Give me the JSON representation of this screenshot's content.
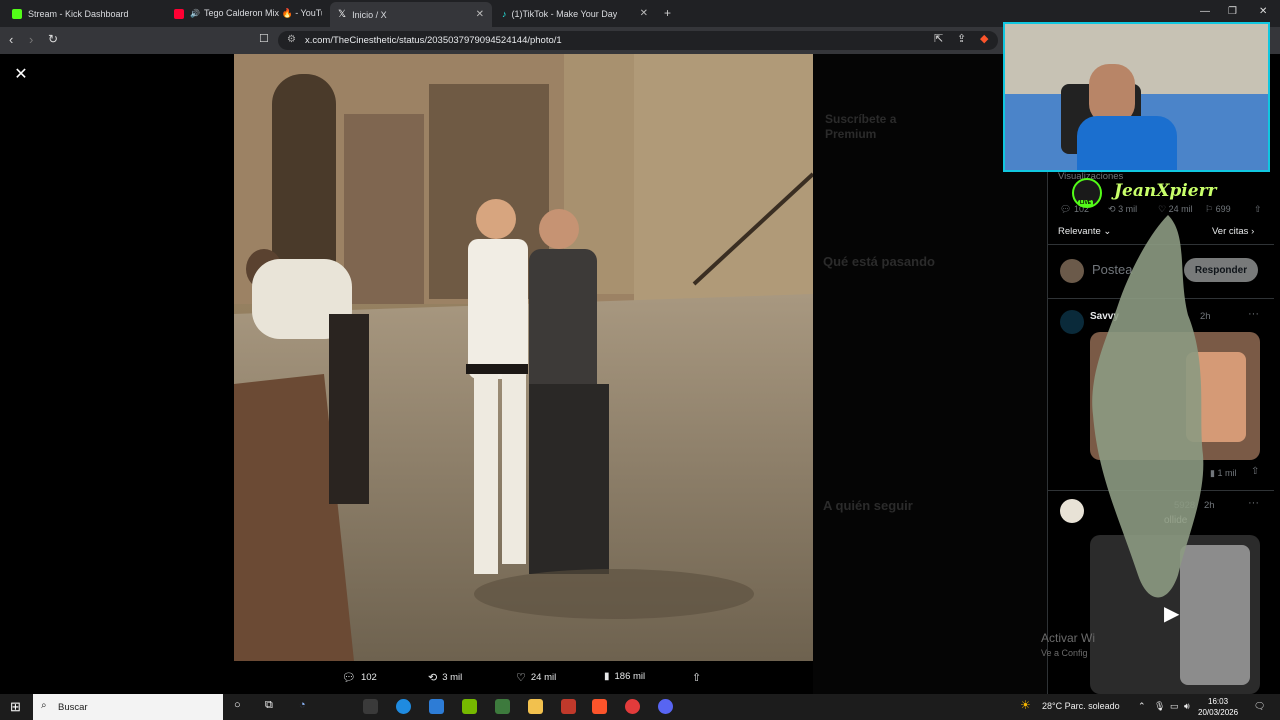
{
  "browser": {
    "tabs": [
      {
        "title": "Stream - Kick Dashboard",
        "favicon_color": "#53fc18"
      },
      {
        "title": "Tego Calderon Mix 🔥 - YouTube",
        "favicon_color": "#ff0033"
      },
      {
        "title": "Inicio / X",
        "favicon_color": "#ffffff"
      },
      {
        "title": "(1)TikTok - Make Your Day",
        "favicon_color": "#25f4ee"
      }
    ],
    "url": "x.com/TheCinesthetic/status/2035037979094524144/photo/1"
  },
  "post": {
    "actions": {
      "replies": "102",
      "reposts": "3 mil",
      "likes": "24 mil",
      "views": "186 mil"
    }
  },
  "sidebar_dimmed": {
    "premium_title": "Suscríbete a Premium",
    "trending_title": "Qué está pasando",
    "follow_title": "A quién seguir"
  },
  "panel": {
    "views_label": "Visualizaciones",
    "stats": {
      "replies": "102",
      "reposts": "3 mil",
      "likes": "24 mil",
      "bookmarks": "699"
    },
    "sort_label": "Relevante",
    "quotes_label": "Ver citas",
    "reply_placeholder": "Postea",
    "reply_button": "Responder",
    "replies": [
      {
        "author": "Savvy",
        "time": "2h",
        "views": "1 mil"
      },
      {
        "handle_tail": "5928",
        "time": "2h",
        "text_tail": "ollide"
      }
    ]
  },
  "stream_overlay": {
    "name": "JeanXpierr",
    "live_badge": "LIVE"
  },
  "windows_watermark": {
    "line1": "Activar Wi",
    "line2": "Ve a Config"
  },
  "taskbar": {
    "search_placeholder": "Buscar",
    "weather": "28°C  Parc. soleado",
    "time": "16:03",
    "date": "20/03/2026"
  }
}
